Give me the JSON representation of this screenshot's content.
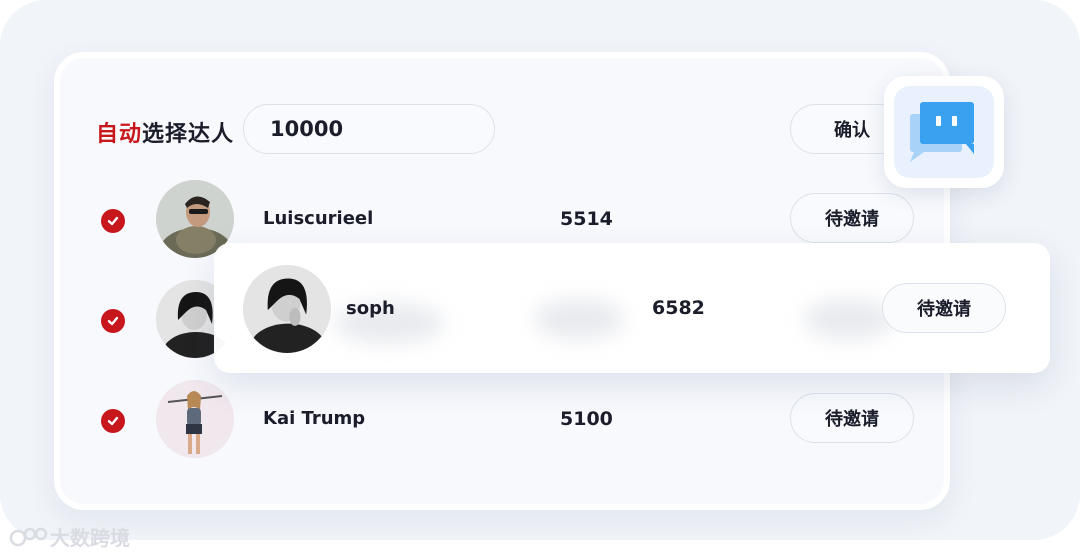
{
  "header": {
    "title_accent": "自动",
    "title_rest": "选择达人",
    "input_value": "10000",
    "confirm_label": "确认"
  },
  "rows": [
    {
      "name": "Luiscurieel",
      "count": "5514",
      "action": "待邀请",
      "checked": true
    },
    {
      "name": "soph",
      "count": "6582",
      "action": "待邀请",
      "checked": true
    },
    {
      "name": "Kai Trump",
      "count": "5100",
      "action": "待邀请",
      "checked": true
    }
  ],
  "watermark": "大数跨境",
  "icons": {
    "chat": "chat-bubble-icon",
    "check": "check-circle-icon"
  },
  "colors": {
    "accent_red": "#c8161d",
    "chat_blue": "#3aa0f0"
  }
}
